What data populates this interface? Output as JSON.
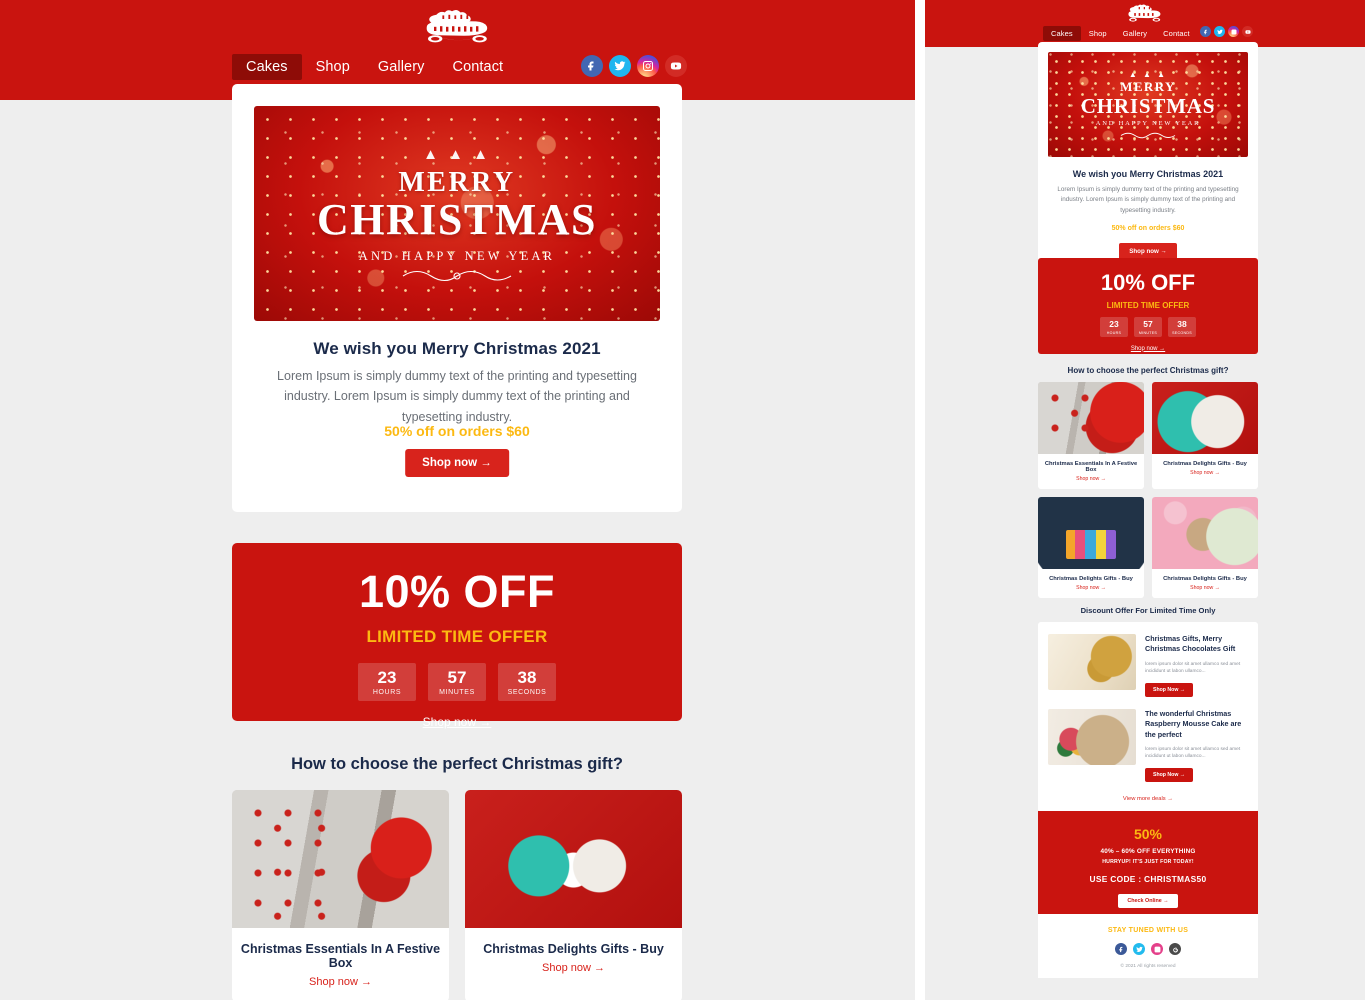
{
  "brand": {
    "logo_text_line1": "Merry",
    "logo_text_line2": "Christmas",
    "primary_red": "#c9140f",
    "button_red": "#d8231c",
    "accent_yellow": "#fcb912",
    "heading_navy": "#1b2a4a",
    "page_bg": "#eeeeee"
  },
  "header": {
    "nav": [
      {
        "label": "Cakes",
        "active": true
      },
      {
        "label": "Shop",
        "active": false
      },
      {
        "label": "Gallery",
        "active": false
      },
      {
        "label": "Contact",
        "active": false
      }
    ],
    "social": [
      {
        "name": "facebook-icon",
        "color": "#4267b2"
      },
      {
        "name": "twitter-icon",
        "color": "#1fb6ef"
      },
      {
        "name": "instagram-icon",
        "color": "#d6249f"
      },
      {
        "name": "youtube-icon",
        "color": "#d22b25"
      }
    ]
  },
  "hero": {
    "banner_trees": "▲ ▲ ▲",
    "banner_line1": "MERRY",
    "banner_line2": "CHRISTMAS",
    "banner_line3": "AND HAPPY NEW YEAR",
    "title": "We wish you Merry Christmas 2021",
    "body": "Lorem Ipsum is simply dummy text of the printing and typesetting industry. Lorem Ipsum is simply dummy text of the printing and typesetting industry.",
    "offer": "50% off on orders $60",
    "cta": "Shop now  →"
  },
  "offer_banner": {
    "percent": "10% OFF",
    "subtitle": "LIMITED TIME OFFER",
    "timers": [
      {
        "value": "23",
        "label": "HOURS"
      },
      {
        "value": "57",
        "label": "MINUTES"
      },
      {
        "value": "38",
        "label": "SECONDS"
      }
    ],
    "cta": "Shop now  →"
  },
  "gifts": {
    "title": "How to choose the perfect Christmas gift?",
    "cta": "Shop now  →",
    "items": [
      {
        "name": "Christmas Essentials In A Festive Box",
        "image": "ph-tree"
      },
      {
        "name": "Christmas Delights Gifts - Buy",
        "image": "ph-santa"
      },
      {
        "name": "Christmas Delights Gifts - Buy",
        "image": "ph-gifts-illu"
      },
      {
        "name": "Christmas Delights Gifts - Buy",
        "image": "ph-pink"
      }
    ]
  },
  "deals": {
    "title": "Discount Offer For Limited Time Only",
    "view_more": "View more deals  →",
    "cta": "Shop Now  →",
    "items": [
      {
        "title": "Christmas Gifts, Merry Christmas Chocolates Gift",
        "text": "lorem ipsum dolor sit amet ullamco sed amet incididunt ut labon ullamco...",
        "image": "ph-gold"
      },
      {
        "title": "The wonderful Christmas Raspberry Mousse Cake are the perfect",
        "text": "lorem ipsum dolor sit amet ullamco sed amet incididunt ut labon ullamco...",
        "image": "ph-flowers"
      }
    ]
  },
  "promo": {
    "percent": "50%",
    "line1": "40% – 60% OFF EVERYTHING",
    "line2": "HURRYUP! IT'S JUST FOR TODAY!",
    "code": "USE CODE : CHRISTMAS50",
    "cta": "Check Online  →"
  },
  "footer": {
    "title": "STAY TUNED WITH US",
    "copyright": "© 2021 All rights reserved",
    "social": [
      {
        "name": "facebook-icon",
        "color": "#3b5998"
      },
      {
        "name": "twitter-icon",
        "color": "#22bbee"
      },
      {
        "name": "instagram-icon",
        "color": "#e4408a"
      },
      {
        "name": "google-icon",
        "color": "#4a4a4a"
      }
    ]
  }
}
